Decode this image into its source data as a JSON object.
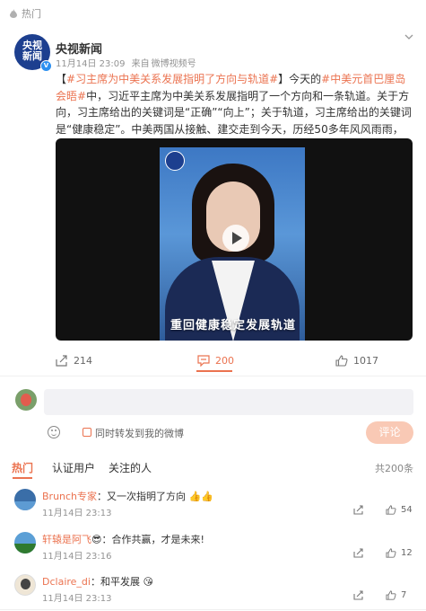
{
  "header": {
    "hot_tag": "热门"
  },
  "post": {
    "author": "央视新闻",
    "avatar_text": [
      "央视",
      "新闻"
    ],
    "verified_mark": "V",
    "time": "11月14日 23:09",
    "source_prefix": "来自",
    "source": "微博视频号",
    "text_parts": [
      {
        "type": "text",
        "value": "【"
      },
      {
        "type": "tag",
        "value": "#习主席为中美关系发展指明了方向与轨道#"
      },
      {
        "type": "text",
        "value": "】今天的"
      },
      {
        "type": "tag",
        "value": "#中美元首巴厘岛会晤#"
      },
      {
        "type": "text",
        "value": "中，习近平主席为中美关系发展指明了一个方向和一条轨道。关于方向，习主席给出的关键词是“正确”“向上”；关于轨道，习主席给出的关键词是“健康稳定”。中美两国从接触、建交走到今天，历经50多年风风雨雨，有得也有失，有经 "
      },
      {
        "type": "more",
        "value": "展开"
      }
    ],
    "video_caption": "重回健康稳定发展轨道",
    "actions": {
      "share": "214",
      "comment": "200",
      "like": "1017"
    }
  },
  "composer": {
    "placeholder": "",
    "repost_label": "同时转发到我的微博",
    "send_label": "评论"
  },
  "tabs": {
    "hot": "热门",
    "verified": "认证用户",
    "following": "关注的人",
    "total": "共200条"
  },
  "comments": [
    {
      "name": "Brunch专家",
      "text": "：又一次指明了方向",
      "emoji": [
        "👍",
        "👍"
      ],
      "time": "11月14日 23:13",
      "likes": "54",
      "avatar_color": "#3a6ea8"
    },
    {
      "name": "轩辕是阿飞",
      "badge": "😎",
      "text": "：合作共赢，才是未来!",
      "time": "11月14日 23:16",
      "likes": "12",
      "avatar_color": "#4a8a4a"
    },
    {
      "name": "Dclaire_di",
      "text": "：和平发展",
      "emoji": [
        "😘"
      ],
      "time": "11月14日 23:13",
      "likes": "7",
      "avatar_color": "#e8e0d0"
    }
  ],
  "colors": {
    "accent": "#eb7350",
    "brand_blue": "#1d3f8f",
    "meta_gray": "#939393"
  }
}
